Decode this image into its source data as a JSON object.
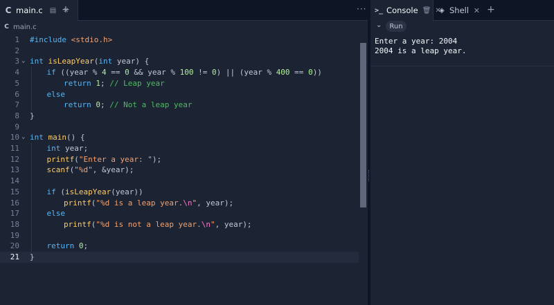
{
  "editor_tab": {
    "label": "main.c"
  },
  "breadcrumb": {
    "label": "main.c"
  },
  "code_lines": [
    {
      "n": "1",
      "fold": "",
      "indent": 0,
      "html": "<span class=\"pp\">#include</span> <span class=\"str\">&lt;stdio.h&gt;</span>"
    },
    {
      "n": "2",
      "fold": "",
      "indent": 0,
      "html": ""
    },
    {
      "n": "3",
      "fold": "⌄",
      "indent": 0,
      "html": "<span class=\"kw\">int</span> <span class=\"fn\">isLeapYear</span>(<span class=\"kw\">int</span> year) {"
    },
    {
      "n": "4",
      "fold": "",
      "indent": 1,
      "html": "<span class=\"kw\">if</span> ((year % <span class=\"num\">4</span> == <span class=\"num\">0</span> &amp;&amp; year % <span class=\"num\">100</span> != <span class=\"num\">0</span>) || (year % <span class=\"num\">400</span> == <span class=\"num\">0</span>))"
    },
    {
      "n": "5",
      "fold": "",
      "indent": 2,
      "html": "<span class=\"kw\">return</span> <span class=\"num\">1</span>; <span class=\"com\">// Leap year</span>"
    },
    {
      "n": "6",
      "fold": "",
      "indent": 1,
      "html": "<span class=\"kw\">else</span>"
    },
    {
      "n": "7",
      "fold": "",
      "indent": 2,
      "html": "<span class=\"kw\">return</span> <span class=\"num\">0</span>; <span class=\"com\">// Not a leap year</span>"
    },
    {
      "n": "8",
      "fold": "",
      "indent": 0,
      "html": "}"
    },
    {
      "n": "9",
      "fold": "",
      "indent": 0,
      "html": ""
    },
    {
      "n": "10",
      "fold": "⌄",
      "indent": 0,
      "html": "<span class=\"kw\">int</span> <span class=\"fn\">main</span>() {"
    },
    {
      "n": "11",
      "fold": "",
      "indent": 1,
      "html": "<span class=\"kw\">int</span> year;"
    },
    {
      "n": "12",
      "fold": "",
      "indent": 1,
      "html": "<span class=\"fn\">printf</span>(<span class=\"str\">\"Enter a year: \"</span>);"
    },
    {
      "n": "13",
      "fold": "",
      "indent": 1,
      "html": "<span class=\"fn\">scanf</span>(<span class=\"str\">\"%d\"</span>, &amp;year);"
    },
    {
      "n": "14",
      "fold": "",
      "indent": 0,
      "html": ""
    },
    {
      "n": "15",
      "fold": "",
      "indent": 1,
      "html": "<span class=\"kw\">if</span> (<span class=\"fn\">isLeapYear</span>(year))"
    },
    {
      "n": "16",
      "fold": "",
      "indent": 2,
      "html": "<span class=\"fn\">printf</span>(<span class=\"str\">\"%d is a leap year.<span class=\"esc\">\\n</span>\"</span>, year);"
    },
    {
      "n": "17",
      "fold": "",
      "indent": 1,
      "html": "<span class=\"kw\">else</span>"
    },
    {
      "n": "18",
      "fold": "",
      "indent": 2,
      "html": "<span class=\"fn\">printf</span>(<span class=\"str\">\"%d is not a leap year.<span class=\"esc\">\\n</span>\"</span>, year);"
    },
    {
      "n": "19",
      "fold": "",
      "indent": 0,
      "html": ""
    },
    {
      "n": "20",
      "fold": "",
      "indent": 1,
      "html": "<span class=\"kw\">return</span> <span class=\"num\">0</span>;"
    },
    {
      "n": "21",
      "fold": "",
      "indent": 0,
      "html": "}",
      "active": true
    }
  ],
  "right_tabs": {
    "console": "Console",
    "shell": "Shell"
  },
  "toolbar": {
    "run": "Run"
  },
  "console": {
    "line1": "Enter a year: 2004",
    "line2": "2004 is a leap year."
  },
  "colors": {
    "background": "#1c2333",
    "tabbar": "#0e1525",
    "keyword": "#56b6f5",
    "function": "#ffcc66",
    "string": "#f4a26f",
    "number": "#b0f29c",
    "comment": "#4cbd5e"
  }
}
